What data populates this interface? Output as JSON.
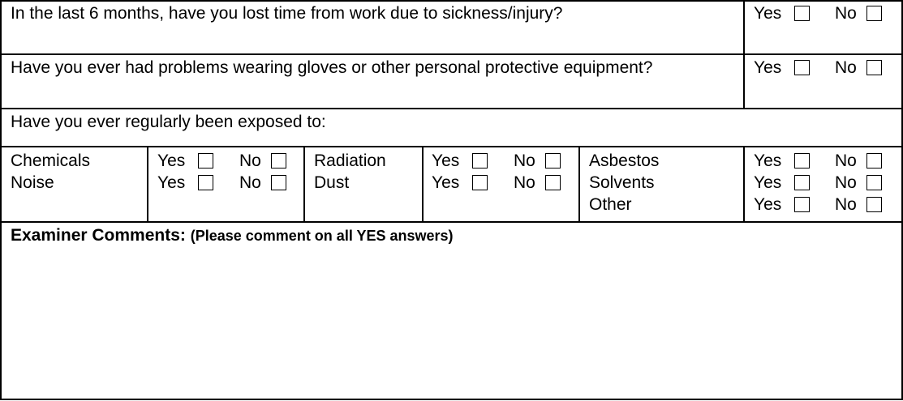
{
  "questions": [
    {
      "text": "In the last 6 months, have you lost time from work due to sickness/injury?",
      "yes": "Yes",
      "no": "No"
    },
    {
      "text": "Have you ever had problems wearing gloves or other personal protective equipment?",
      "yes": "Yes",
      "no": "No"
    }
  ],
  "exposure": {
    "prompt": "Have you  ever regularly been exposed to:",
    "col1": [
      "Chemicals",
      "Noise"
    ],
    "col2": [
      "Radiation",
      "Dust"
    ],
    "col3": [
      "Asbestos",
      "Solvents",
      "Other"
    ],
    "yes": "Yes",
    "no": "No"
  },
  "comments": {
    "title": "Examiner Comments:",
    "note": "(Please comment on all YES answers)"
  }
}
